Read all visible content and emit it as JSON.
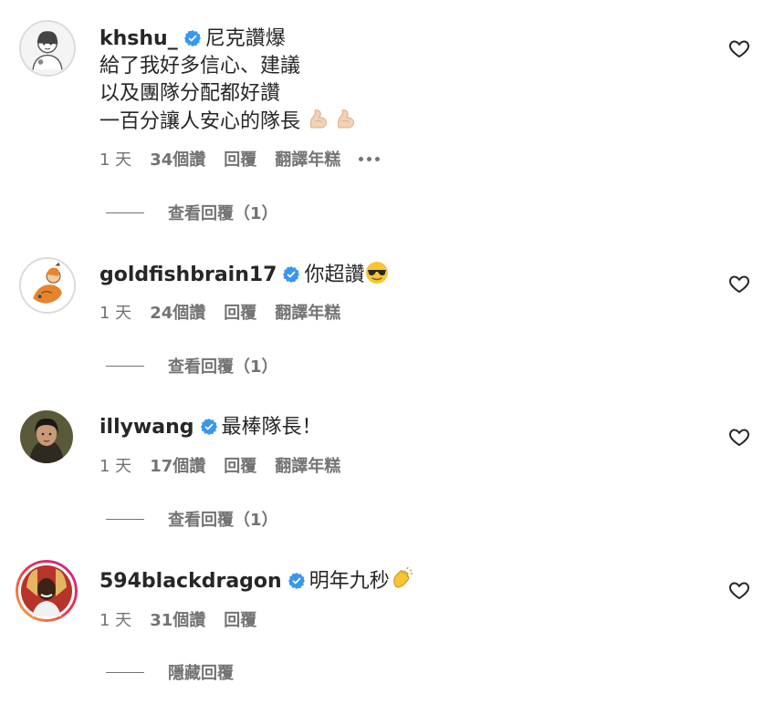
{
  "comments": [
    {
      "username": "khshu_",
      "verified": true,
      "lines": [
        "尼克讚爆",
        "給了我好多信心、建議",
        "以及團隊分配都好讚",
        "一百分讓人安心的隊長"
      ],
      "emoji_names": [
        "flexed-biceps-icon",
        "flexed-biceps-icon"
      ],
      "time": "1 天",
      "likes": "34個讚",
      "reply": "回覆",
      "translate": "翻譯年糕",
      "has_more": true,
      "replies_toggle": "查看回覆（1）"
    },
    {
      "username": "goldfishbrain17",
      "verified": true,
      "lines": [
        "你超讚"
      ],
      "emoji_names": [
        "sunglasses-face-icon"
      ],
      "time": "1 天",
      "likes": "24個讚",
      "reply": "回覆",
      "translate": "翻譯年糕",
      "replies_toggle": "查看回覆（1）"
    },
    {
      "username": "illywang",
      "verified": true,
      "lines": [
        "最棒隊長！"
      ],
      "time": "1 天",
      "likes": "17個讚",
      "reply": "回覆",
      "translate": "翻譯年糕",
      "replies_toggle": "查看回覆（1）"
    },
    {
      "username": "594blackdragon",
      "verified": true,
      "lines": [
        "明年九秒"
      ],
      "emoji_names": [
        "clapping-hands-icon"
      ],
      "time": "1 天",
      "likes": "31個讚",
      "reply": "回覆",
      "replies_toggle": "隱藏回覆"
    }
  ],
  "colors": {
    "text": "#262626",
    "secondary": "#737373",
    "verified": "#3897f0"
  }
}
